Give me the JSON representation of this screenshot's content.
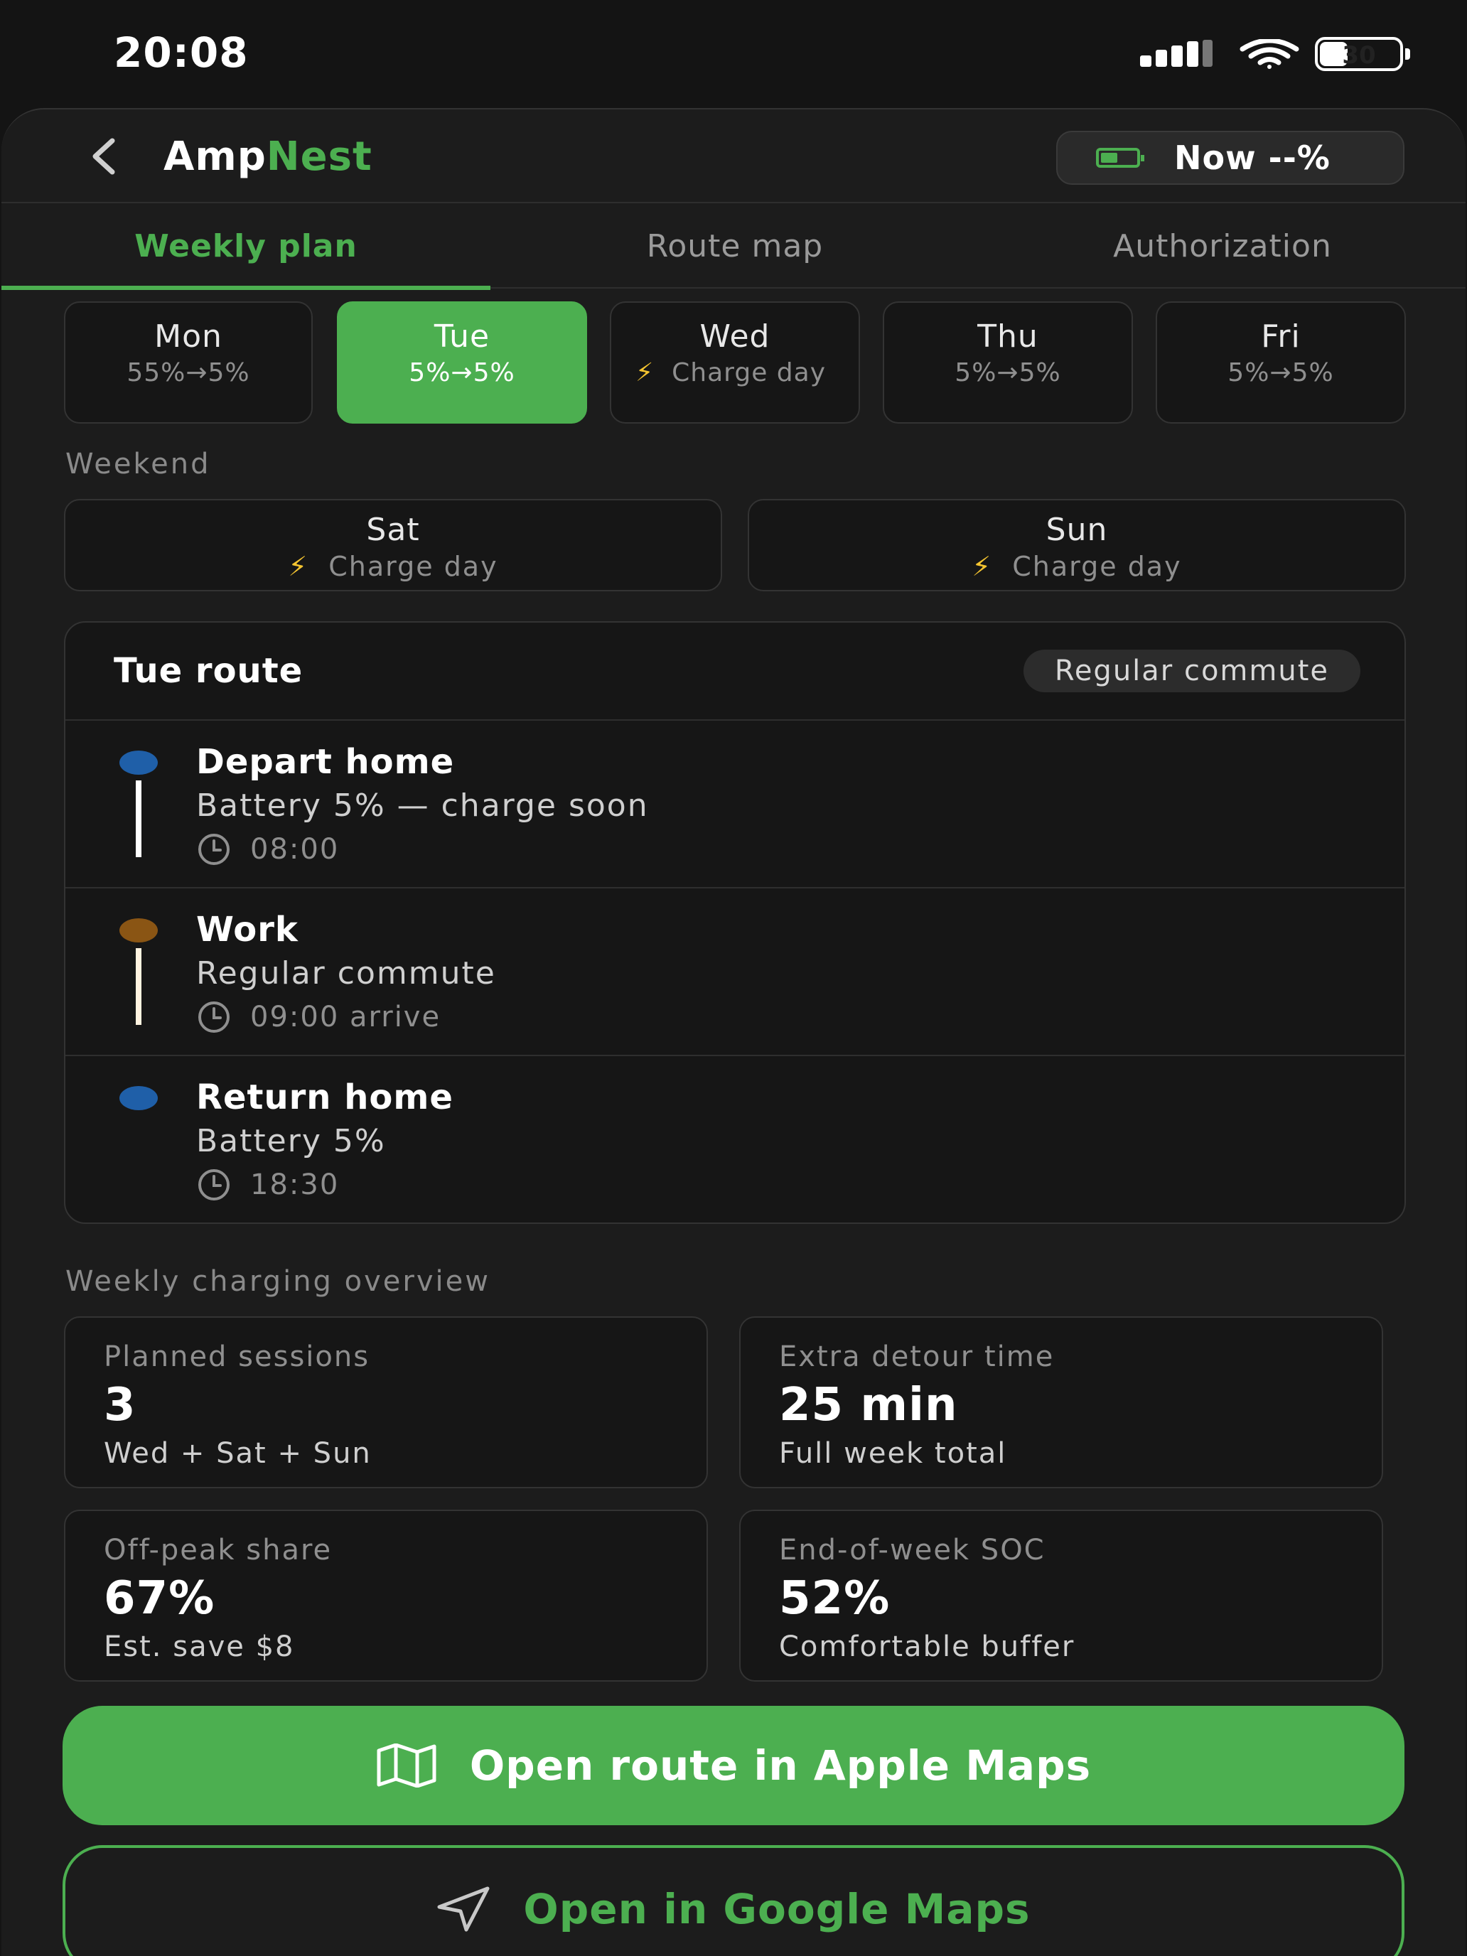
{
  "status_bar": {
    "time": "20:08",
    "battery": "30"
  },
  "header": {
    "title_prefix": "Amp",
    "title_accent": "Nest",
    "now_label": "Now --%"
  },
  "tabs": [
    {
      "label": "Weekly plan",
      "active": true
    },
    {
      "label": "Route map",
      "active": false
    },
    {
      "label": "Authorization",
      "active": false
    }
  ],
  "weekdays": [
    {
      "day": "Mon",
      "detail": "55%→5%",
      "active": false
    },
    {
      "day": "Tue",
      "detail": "5%→5%",
      "active": true
    },
    {
      "day": "Wed",
      "detail": "Charge day",
      "icon": "lightning-icon",
      "active": false
    },
    {
      "day": "Thu",
      "detail": "5%→5%",
      "active": false
    },
    {
      "day": "Fri",
      "detail": "5%→5%",
      "active": false
    }
  ],
  "weekend": {
    "label": "Weekend",
    "days": [
      {
        "day": "Sat",
        "detail": "Charge day",
        "icon": "lightning-icon"
      },
      {
        "day": "Sun",
        "detail": "Charge day",
        "icon": "lightning-icon"
      }
    ]
  },
  "route": {
    "title": "Tue route",
    "tag": "Regular commute",
    "stops": [
      {
        "title": "Depart home",
        "subtitle": "Battery 5% — charge soon",
        "time": "08:00",
        "dot_color": "#1f5fa8",
        "line_color": "#ffffff"
      },
      {
        "title": "Work",
        "subtitle": "Regular commute",
        "time": "09:00 arrive",
        "dot_color": "#8a5514",
        "line_color": "#fff3e0"
      },
      {
        "title": "Return home",
        "subtitle": "Battery 5%",
        "time": "18:30",
        "dot_color": "#1f5fa8"
      }
    ]
  },
  "overview": {
    "label": "Weekly charging overview",
    "stats": [
      {
        "label": "Planned sessions",
        "value": "3",
        "note": "Wed + Sat + Sun"
      },
      {
        "label": "Extra detour time",
        "value": "25 min",
        "note": "Full week total"
      },
      {
        "label": "Off-peak share",
        "value": "67%",
        "note": "Est. save $8"
      },
      {
        "label": "End-of-week SOC",
        "value": "52%",
        "note": "Comfortable buffer"
      }
    ]
  },
  "actions": {
    "apple_maps": "Open route in Apple Maps",
    "google_maps": "Open in Google Maps"
  },
  "colors": {
    "accent": "#4caf50",
    "background": "#1c1c1c",
    "card": "#161616",
    "bolt": "#f4c430"
  }
}
